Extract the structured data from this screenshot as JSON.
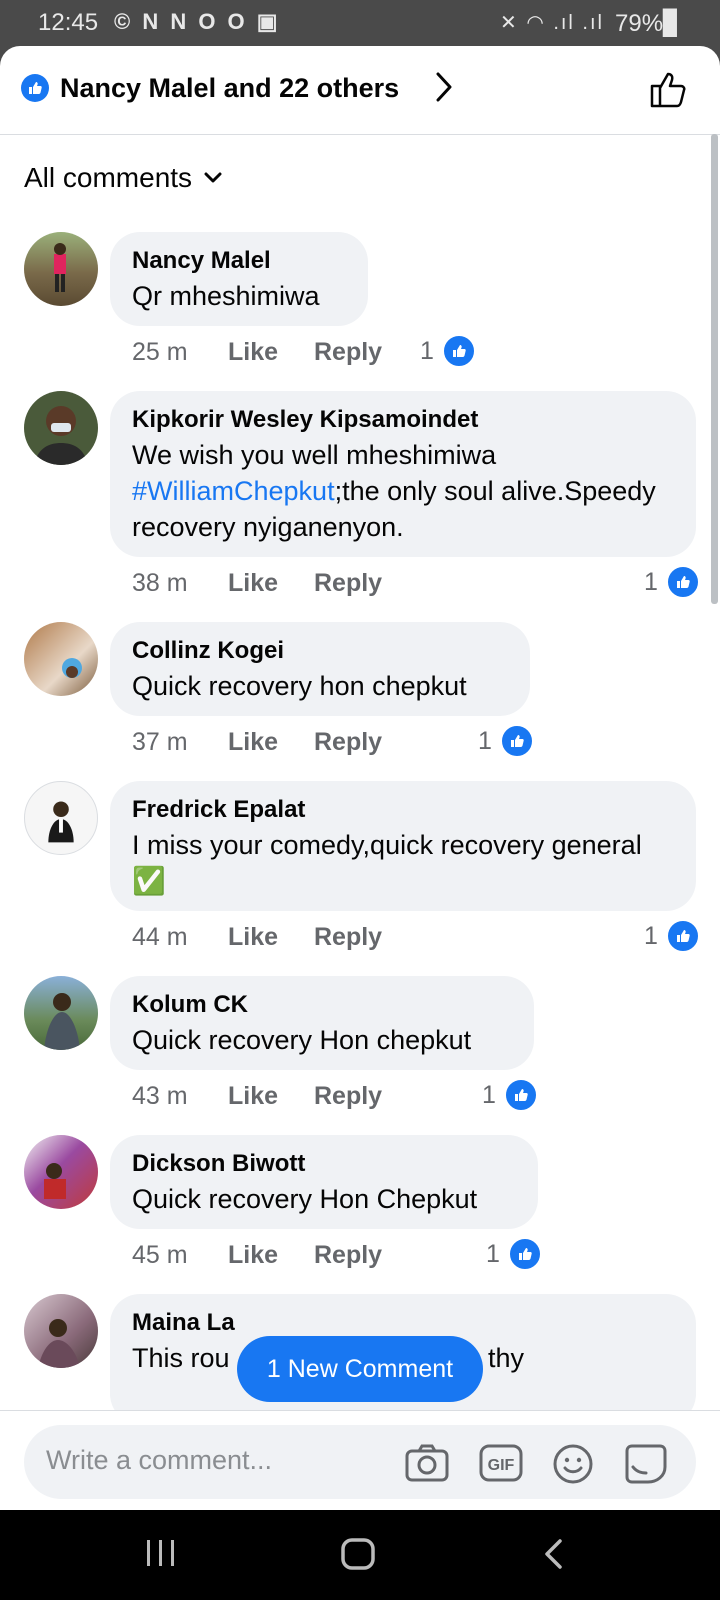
{
  "status_bar": {
    "time": "12:45",
    "left_icons": "© N N O O ▣",
    "right_icons": "✕ ◠ .ıl .ıl",
    "battery": "79%▊"
  },
  "header": {
    "title": "Nancy Malel and 22 others"
  },
  "filter": {
    "label": "All comments"
  },
  "comments": [
    {
      "author": "Nancy Malel",
      "text": "Qr mheshimiwa",
      "time": "25 m",
      "like": "Like",
      "reply": "Reply",
      "reactions": "1",
      "avatar_color": "#7a6a4a"
    },
    {
      "author": "Kipkorir Wesley Kipsamoindet",
      "text_before_tag": "We wish you well mheshimiwa ",
      "tag": "#WilliamChepkut",
      "text_after_tag": ";the only soul alive.Speedy recovery nyiganenyon.",
      "time": "38 m",
      "like": "Like",
      "reply": "Reply",
      "reactions": "1",
      "avatar_color": "#3e4a3a"
    },
    {
      "author": "Collinz Kogei",
      "text": "Quick recovery hon chepkut",
      "time": "37 m",
      "like": "Like",
      "reply": "Reply",
      "reactions": "1",
      "avatar_color": "#8a5a3a"
    },
    {
      "author": "Fredrick Epalat",
      "text": "I miss your comedy,quick recovery general ✅",
      "time": "44 m",
      "like": "Like",
      "reply": "Reply",
      "reactions": "1",
      "avatar_color": "#f4f4f4"
    },
    {
      "author": "Kolum CK",
      "text": "Quick recovery Hon chepkut",
      "time": "43 m",
      "like": "Like",
      "reply": "Reply",
      "reactions": "1",
      "avatar_color": "#5a7a5a"
    },
    {
      "author": "Dickson Biwott",
      "text": "Quick recovery Hon Chepkut",
      "time": "45 m",
      "like": "Like",
      "reply": "Reply",
      "reactions": "1",
      "avatar_color": "#9a4a8a"
    },
    {
      "author": "Maina La",
      "text_left": "This rou",
      "text_right": "thy",
      "avatar_color": "#8a6a7a"
    }
  ],
  "new_comment_pill": "1 New Comment",
  "composer": {
    "placeholder": "Write a comment...",
    "icons": [
      "camera-icon",
      "gif-icon",
      "emoji-icon",
      "sticker-icon"
    ]
  },
  "colors": {
    "accent": "#1877f2",
    "bubble": "#f0f2f5",
    "secondary_text": "#65676b"
  }
}
